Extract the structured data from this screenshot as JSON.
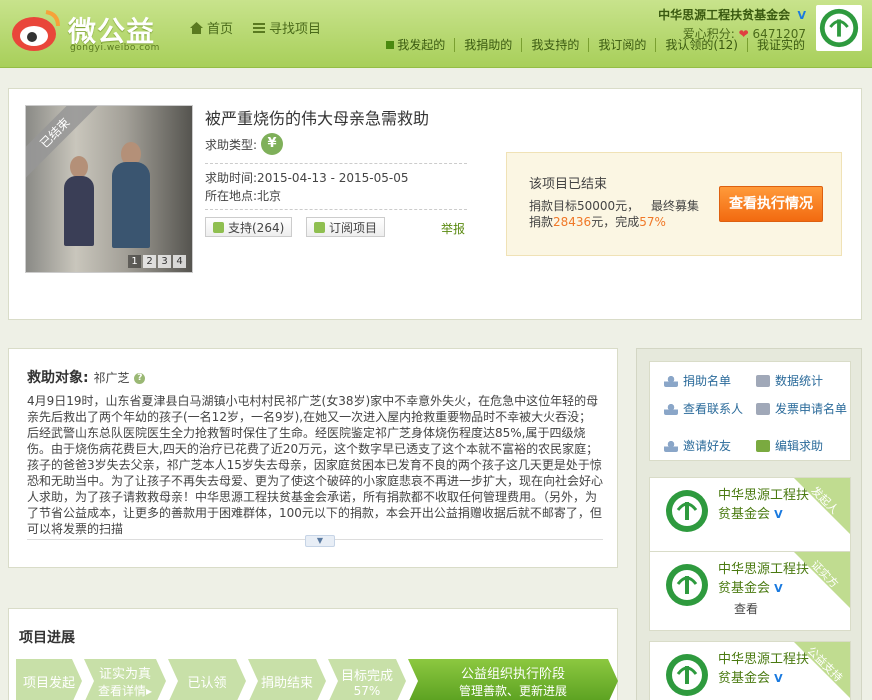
{
  "header": {
    "logo_text": "微公益",
    "logo_sub": "gongyi.weibo.com",
    "nav": [
      {
        "label": "首页",
        "icon": "home-icon"
      },
      {
        "label": "寻找项目",
        "icon": "list-icon"
      }
    ],
    "user_name": "中华思源工程扶贫基金会",
    "points_label": "爱心积分:",
    "points_value": "6471207",
    "subnav": [
      "我发起的",
      "我捐助的",
      "我支持的",
      "我订阅的",
      "我认领的(12)",
      "我证实的"
    ]
  },
  "project": {
    "ribbon": "已结束",
    "pager": [
      "1",
      "2",
      "3",
      "4"
    ],
    "title": "被严重烧伤的伟大母亲急需救助",
    "help_type_label": "求助类型:",
    "help_time_label": "求助时间",
    "help_time_value": ":2015-04-13 - 2015-05-05",
    "location_label": "所在地点",
    "location_value": ":北京",
    "support_label": "支持(264)",
    "subscribe_label": "订阅项目",
    "report_label": "举报",
    "status_title": "该项目已结束",
    "goal_text": "捐款目标50000元，",
    "final_label": "最终募集",
    "raised_prefix": "捐款",
    "raised_value": "28436",
    "raised_suffix": "元，完成",
    "percent": "57%",
    "exec_button": "查看执行情况"
  },
  "description": {
    "heading": "救助对象:",
    "name": "祁广芝",
    "text": "4月9日19时，山东省夏津县白马湖镇小屯村村民祁广芝(女38岁)家中不幸意外失火，在危急中这位年轻的母亲先后救出了两个年幼的孩子(一名12岁，一名9岁),在她又一次进入屋内抢救重要物品时不幸被大火吞没；后经武警山东总队医院医生全力抢救暂时保住了生命。经医院鉴定祁广芝身体烧伤程度达85%,属于四级烧伤。由于烧伤病花费巨大,四天的治疗已花费了近20万元，这个数字早已透支了这个本就不富裕的农民家庭；孩子的爸爸3岁失去父亲，祁广芝本人15岁失去母亲，因家庭贫困本已发育不良的两个孩子这几天更是处于惊恐和无助当中。为了让孩子不再失去母爱、更为了使这个破碎的小家庭悲哀不再进一步扩大，现在向社会好心人求助，为了孩子请救救母亲！中华思源工程扶贫基金会承诺，所有捐款都不收取任何管理费用。（另外，为了节省公益成本，让更多的善款用于困难群体，100元以下的捐款，本会开出公益捐赠收据后就不邮寄了，但可以将发票的扫描"
  },
  "progress": {
    "title": "项目进展",
    "steps": [
      {
        "label": "项目发起",
        "sub": ""
      },
      {
        "label": "证实为真",
        "sub": "查看详情▸"
      },
      {
        "label": "已认领",
        "sub": ""
      },
      {
        "label": "捐助结束",
        "sub": ""
      },
      {
        "label": "目标完成",
        "sub": "57%"
      },
      {
        "label": "公益组织执行阶段",
        "sub": "管理善款、更新进展"
      }
    ]
  },
  "sidebar": {
    "links": [
      {
        "label": "捐助名单",
        "icon": "person-icon"
      },
      {
        "label": "数据统计",
        "icon": "document-icon"
      },
      {
        "label": "查看联系人",
        "icon": "person-icon"
      },
      {
        "label": "发票申请名单",
        "icon": "document-icon"
      },
      {
        "label": "邀请好友",
        "icon": "person-icon"
      },
      {
        "label": "编辑求助",
        "icon": "edit-icon"
      }
    ],
    "orgs": [
      {
        "name": "中华思源工程扶贫基金会",
        "tag": "发起人",
        "view": ""
      },
      {
        "name": "中华思源工程扶贫基金会",
        "tag": "证实方",
        "view": "查看"
      },
      {
        "name": "中华思源工程扶贫基金会",
        "tag": "公益支持",
        "view": ""
      }
    ]
  },
  "colors": {
    "header_green": "#a8cf5a",
    "accent_orange": "#f07828",
    "link_blue": "#2a6a9a",
    "org_green": "#4a7a10"
  }
}
